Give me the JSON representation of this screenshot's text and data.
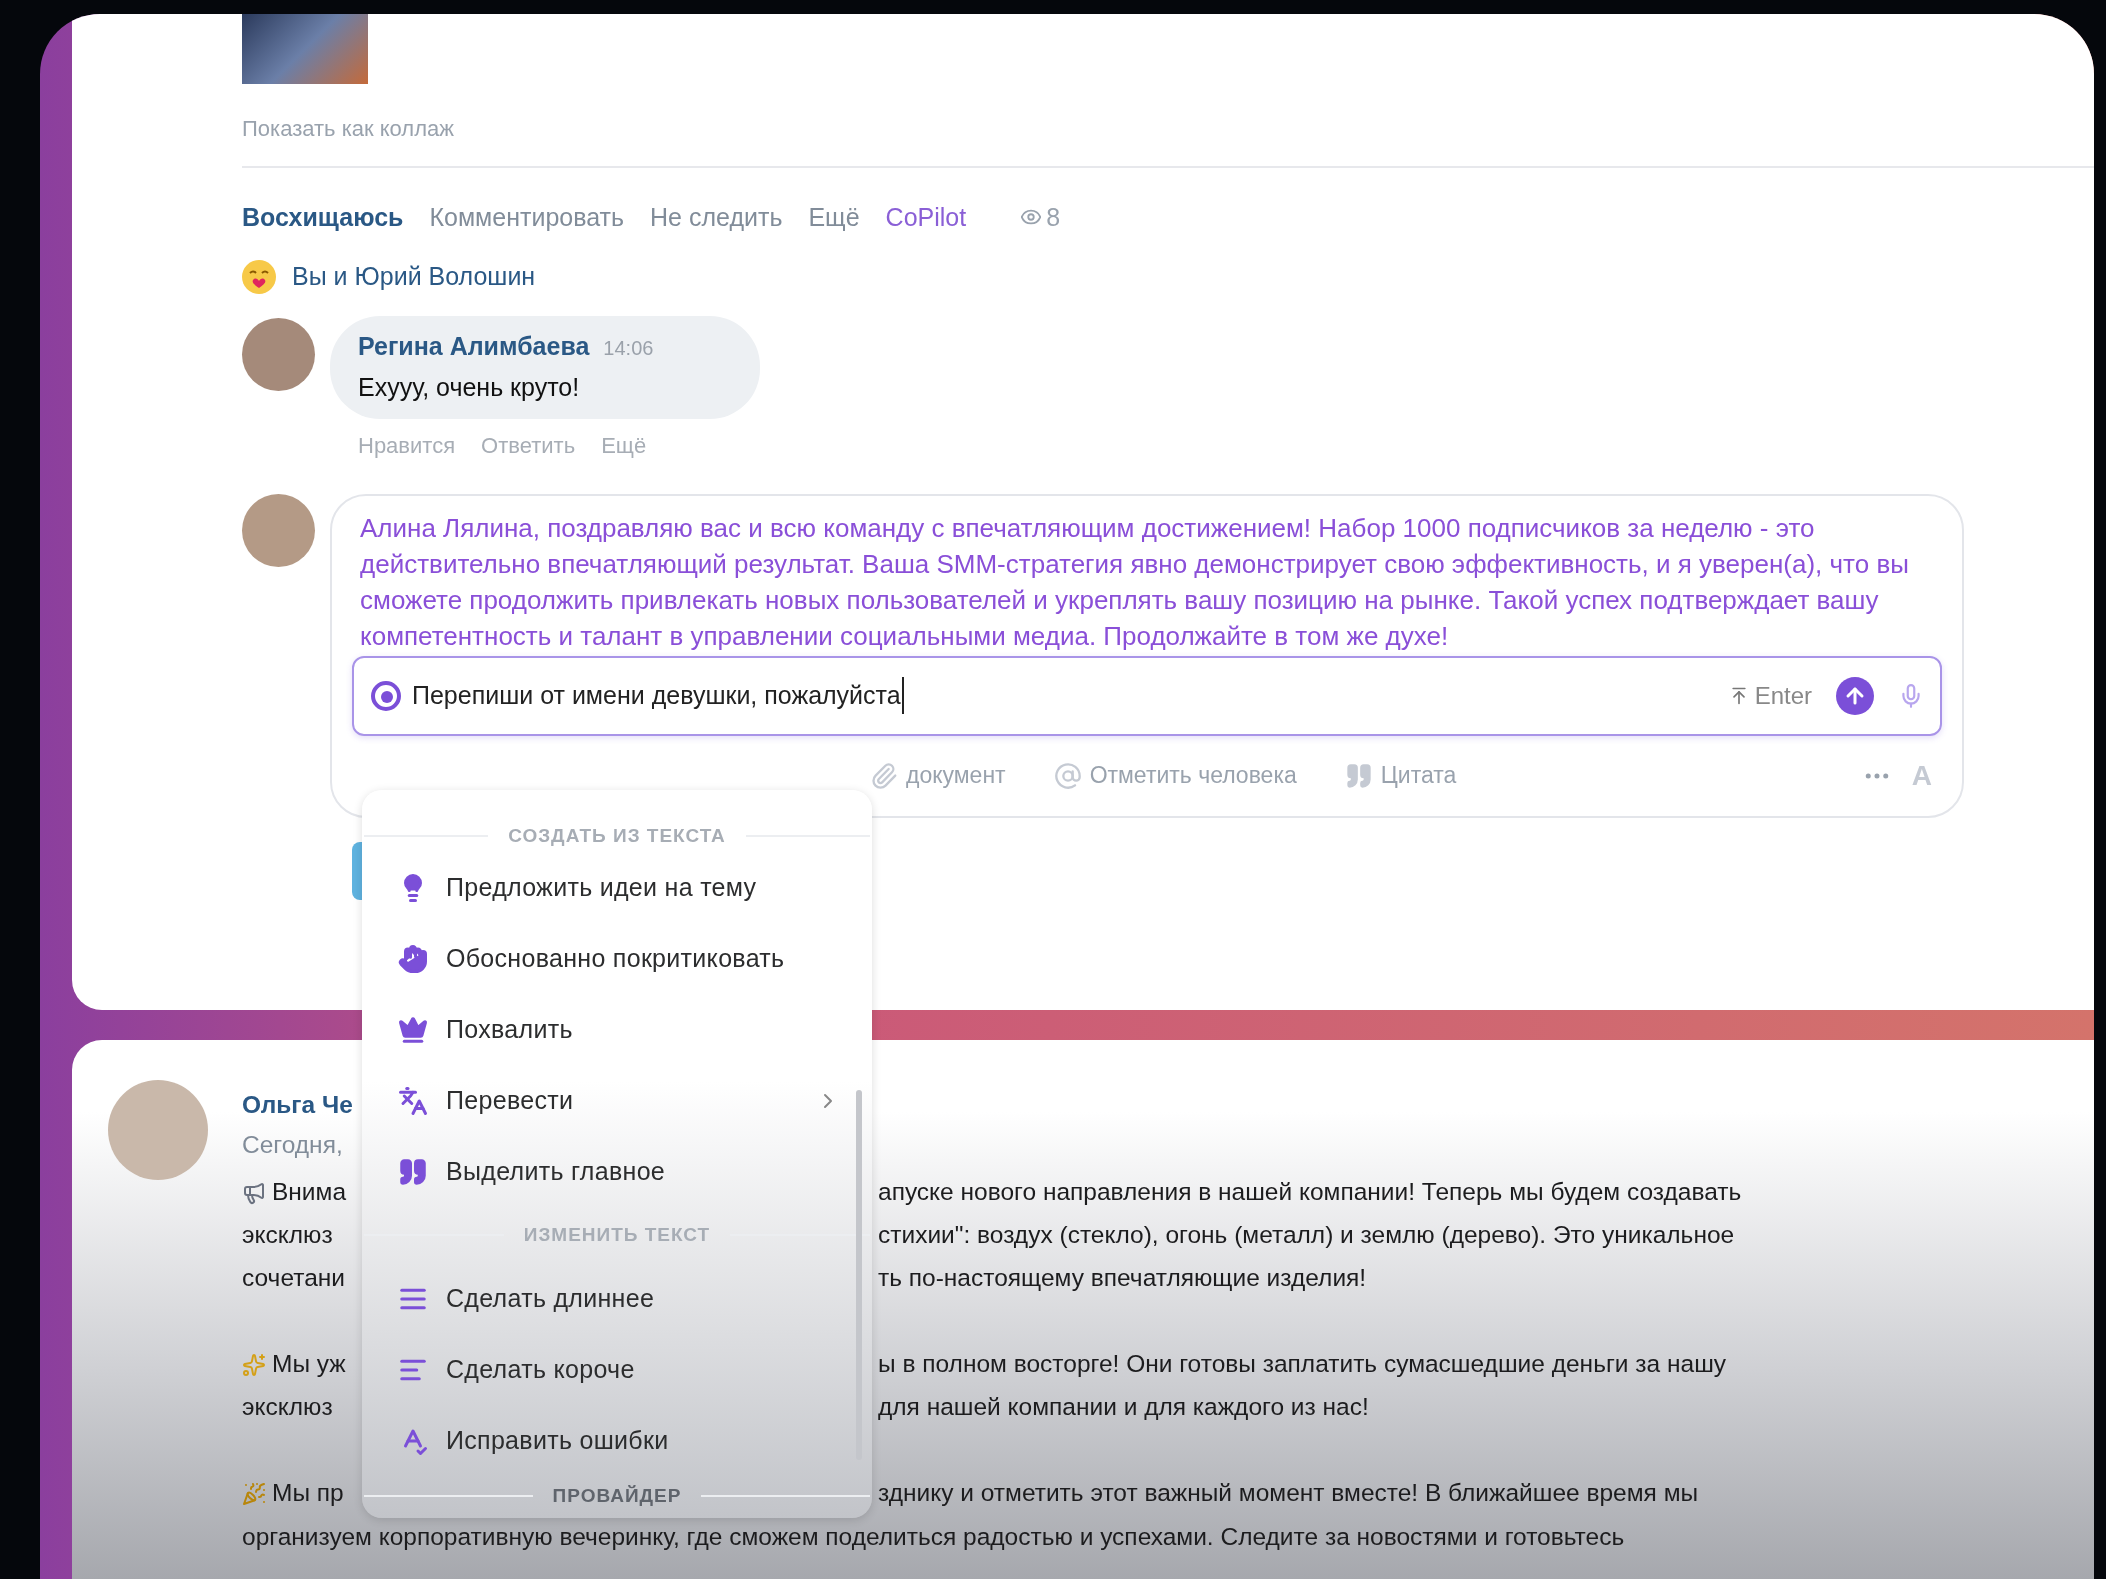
{
  "post": {
    "show_collage": "Показать как коллаж",
    "actions": [
      {
        "label": "Восхищаюсь",
        "kind": "active"
      },
      {
        "label": "Комментировать",
        "kind": "plain"
      },
      {
        "label": "Не следить",
        "kind": "plain"
      },
      {
        "label": "Ещё",
        "kind": "plain"
      },
      {
        "label": "CoPilot",
        "kind": "copilot"
      }
    ],
    "views": "8",
    "reactions": "Вы и Юрий Волошин"
  },
  "comments": [
    {
      "author": "Регина Алимбаева",
      "time": "14:06",
      "text": "Ехууу, очень круто!",
      "actions": [
        "Нравится",
        "Ответить",
        "Ещё"
      ]
    }
  ],
  "composer": {
    "draft": "Алина Лялина, поздравляю вас и всю команду с впечатляющим достижением! Набор 1000 подписчиков за неделю - это действительно впечатляющий результат. Ваша SMM-стратегия явно демонстрирует свою эффективность, и я уверен(а), что вы сможете продолжить привлекать новых пользователей и укреплять вашу позицию на рынке. Такой успех подтверждает вашу компетентность и талант в управлении социальными медиа. Продолжайте в том же духе!",
    "prompt": {
      "value": "Перепиши от имени девушки, пожалуйста",
      "hint": "Enter"
    },
    "toolbar": [
      {
        "label": "документ",
        "kind": "document"
      },
      {
        "label": "Отметить человека",
        "kind": "mention"
      },
      {
        "label": "Цитата",
        "kind": "quote"
      }
    ],
    "format": "A"
  },
  "copilot_menu": {
    "sections": [
      {
        "title": "СОЗДАТЬ ИЗ ТЕКСТА",
        "items": [
          {
            "label": "Предложить идеи на тему",
            "kind": "ideas"
          },
          {
            "label": "Обоснованно покритиковать",
            "kind": "critique"
          },
          {
            "label": "Похвалить",
            "kind": "praise"
          },
          {
            "label": "Перевести",
            "kind": "translate"
          },
          {
            "label": "Выделить главное",
            "kind": "highlight"
          }
        ]
      },
      {
        "title": "ИЗМЕНИТЬ ТЕКСТ",
        "items": [
          {
            "label": "Сделать длиннее",
            "kind": "longer"
          },
          {
            "label": "Сделать короче",
            "kind": "shorter"
          },
          {
            "label": "Исправить ошибки",
            "kind": "fix"
          }
        ]
      },
      {
        "title": "ПРОВАЙДЕР"
      }
    ]
  },
  "feed_post": {
    "author": "Ольга Че",
    "date": "Сегодня,",
    "paragraphs": [
      {
        "kind": "megaphone",
        "lines": [
          {
            "left": "Внима",
            "right": "апуске нового направления в нашей компании! Теперь мы будем создавать"
          },
          {
            "left": "эксклюз",
            "right": "стихии\": воздух (стекло), огонь (металл) и землю (дерево). Это уникальное"
          },
          {
            "left": "сочетани",
            "right": "ть по-настоящему впечатляющие изделия!"
          }
        ]
      },
      {
        "kind": "sparkle",
        "lines": [
          {
            "left": "Мы уж",
            "right": "ы в полном восторге! Они готовы заплатить сумасшедшие деньги за нашу"
          },
          {
            "left": "эксклюз",
            "right": "для нашей компании и для каждого из нас!"
          }
        ]
      },
      {
        "kind": "party",
        "lines": [
          {
            "left": "Мы пр",
            "right": "зднику и отметить этот важный момент вместе! В ближайшее время мы"
          },
          {
            "text": "организуем корпоративную вечеринку, где сможем поделиться радостью и успехами. Следите за новостями и готовьтесь"
          }
        ]
      }
    ]
  }
}
